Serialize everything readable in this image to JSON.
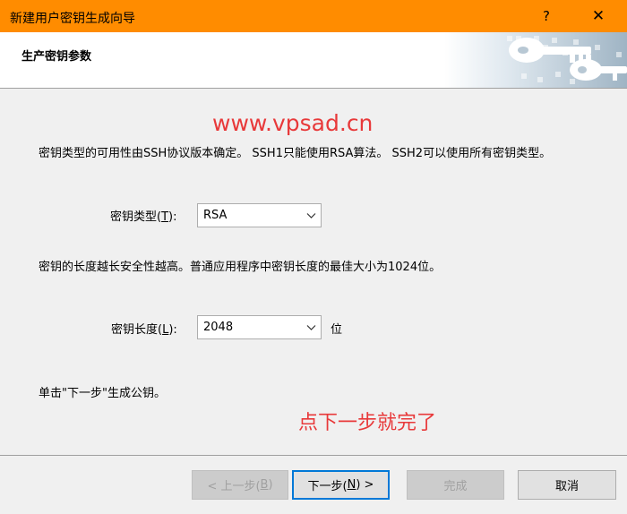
{
  "titlebar": {
    "title": "新建用户密钥生成向导",
    "help_label": "?",
    "close_label": "✕"
  },
  "header": {
    "title": "生产密钥参数"
  },
  "content": {
    "watermark": "www.vpsad.cn",
    "key_type_description": "密钥类型的可用性由SSH协议版本确定。 SSH1只能使用RSA算法。 SSH2可以使用所有密钥类型。",
    "key_type": {
      "label_prefix": "密钥类型(",
      "label_mnemonic": "T",
      "label_suffix": "):",
      "value": "RSA"
    },
    "key_length_description": "密钥的长度越长安全性越高。普通应用程序中密钥长度的最佳大小为1024位。",
    "key_length": {
      "label_prefix": "密钥长度(",
      "label_mnemonic": "L",
      "label_suffix": "):",
      "value": "2048",
      "unit": "位"
    },
    "instruction": "单击\"下一步\"生成公钥。",
    "annotation": "点下一步就完了"
  },
  "buttons": {
    "prev_prefix": "< 上一步(",
    "prev_mnemonic": "B",
    "prev_suffix": ")",
    "next_prefix": "下一步(",
    "next_mnemonic": "N",
    "next_suffix": ") >",
    "finish": "完成",
    "cancel": "取消"
  },
  "colors": {
    "titlebar": "#ff8c00",
    "annotation_red": "#e8393a",
    "focus_blue": "#0078d7"
  }
}
